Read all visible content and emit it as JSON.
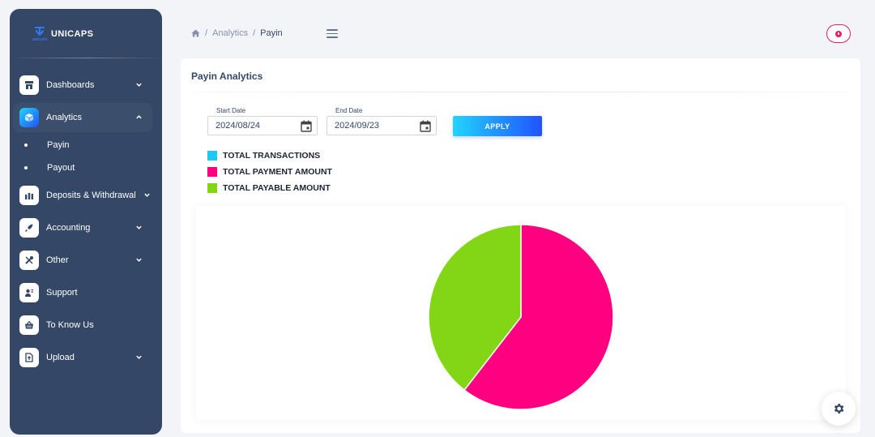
{
  "brand": {
    "name": "UNICAPS",
    "logo_caption": "UNICAPS"
  },
  "sidebar": {
    "items": [
      {
        "label": "Dashboards",
        "icon": "shop-icon"
      },
      {
        "label": "Analytics",
        "icon": "cube-icon"
      },
      {
        "label": "Deposits & Withdrawal",
        "icon": "bank-icon"
      },
      {
        "label": "Accounting",
        "icon": "rocket-icon"
      },
      {
        "label": "Other",
        "icon": "tools-icon"
      },
      {
        "label": "Support",
        "icon": "support-icon"
      },
      {
        "label": "To Know Us",
        "icon": "basket-icon"
      },
      {
        "label": "Upload",
        "icon": "upload-icon"
      }
    ],
    "analytics_subitems": [
      "Payin",
      "Payout"
    ]
  },
  "breadcrumb": {
    "section": "Analytics",
    "current": "Payin",
    "separator": "/"
  },
  "card": {
    "title": "Payin Analytics"
  },
  "filters": {
    "start_label": "Start Date",
    "start_value": "2024/08/24",
    "end_label": "End Date",
    "end_value": "2024/09/23",
    "apply_label": "APPLY"
  },
  "chart_data": {
    "type": "pie",
    "legend_placement": "top-left",
    "series": [
      {
        "name": "TOTAL TRANSACTIONS",
        "value": 0,
        "color": "#1fc8ef"
      },
      {
        "name": "TOTAL PAYMENT AMOUNT",
        "value": 60.5,
        "color": "#ff0080"
      },
      {
        "name": "TOTAL PAYABLE AMOUNT",
        "value": 39.5,
        "color": "#82d616"
      }
    ]
  },
  "colors": {
    "sidebar": "#344767",
    "accent": "#2152ff",
    "pink": "#e91e63"
  }
}
